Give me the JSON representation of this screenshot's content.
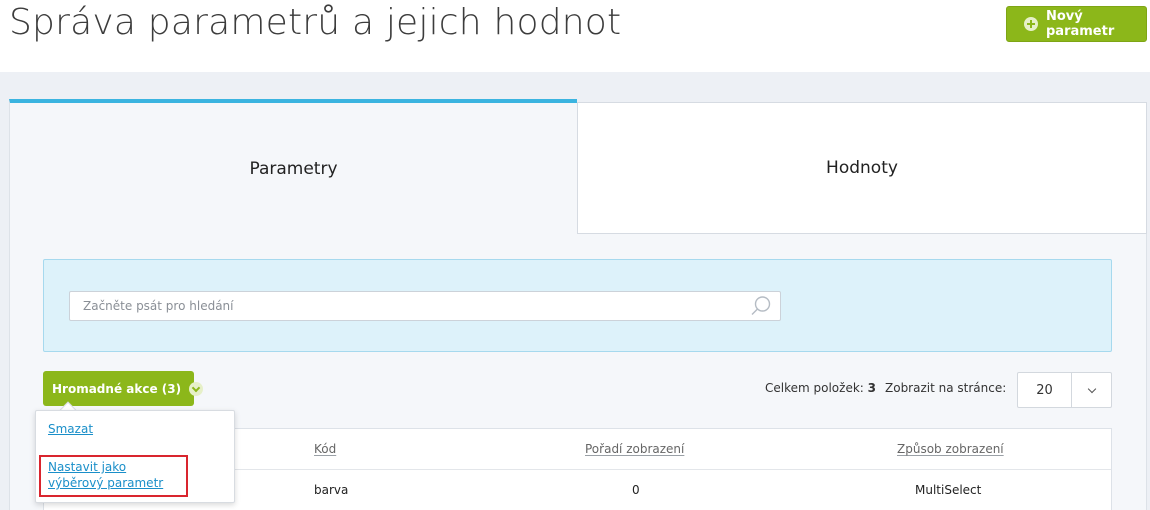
{
  "header": {
    "title": "Správa parametrů a jejich hodnot",
    "new_button_label": "Nový parametr"
  },
  "tabs": [
    {
      "label": "Parametry",
      "active": true
    },
    {
      "label": "Hodnoty",
      "active": false
    }
  ],
  "search": {
    "placeholder": "Začněte psát pro hledání",
    "value": ""
  },
  "bulk_actions": {
    "label": "Hromadné akce (3)",
    "menu": [
      {
        "label": "Smazat"
      },
      {
        "label": "Nastavit jako výběrový parametr"
      }
    ]
  },
  "pagination": {
    "total_label": "Celkem položek:",
    "total_count": "3",
    "per_page_label": "Zobrazit na stránce:",
    "per_page_value": "20"
  },
  "table": {
    "columns": [
      "Kód",
      "Pořadí zobrazení",
      "Způsob zobrazení"
    ],
    "rows": [
      {
        "kod": "barva",
        "poradi": "0",
        "zpusob": "MultiSelect"
      }
    ]
  },
  "colors": {
    "accent_green": "#8cb71a",
    "tab_active_border": "#3bb4e0",
    "search_panel_bg": "#ddf2fa",
    "link_blue": "#1a8fc9",
    "highlight_red": "#d9252e"
  }
}
